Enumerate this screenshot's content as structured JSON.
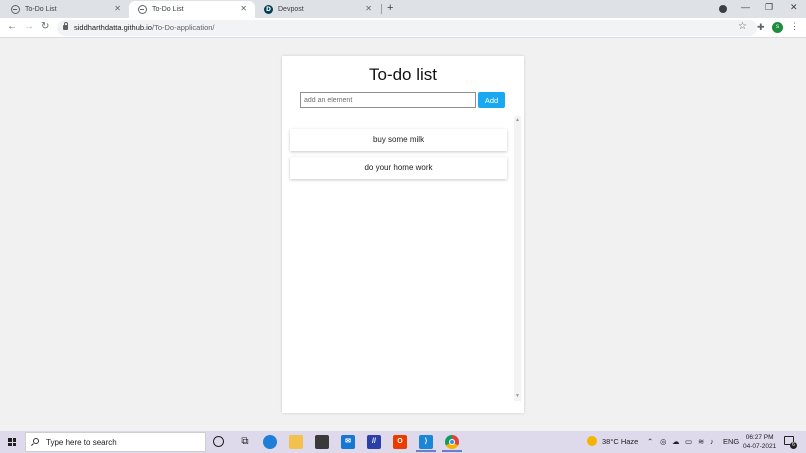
{
  "browser": {
    "tabs": [
      {
        "title": "To-Do List",
        "favicon": "globe-icon",
        "active": false
      },
      {
        "title": "To-Do List",
        "favicon": "globe-icon",
        "active": true
      },
      {
        "title": "Devpost",
        "favicon": "devpost-icon",
        "letter": "D",
        "active": false
      }
    ],
    "new_tab": "+",
    "close_glyph": "✕",
    "window_controls": {
      "minimize": "—",
      "maximize": "❐",
      "close": "✕"
    },
    "url_host": "siddharthdatta.github.io",
    "url_path": "/To-Do-application/",
    "profile_initial": "s"
  },
  "app": {
    "title": "To-do list",
    "input_placeholder": "add an element",
    "input_value": "",
    "add_label": "Add",
    "items": [
      "buy some milk",
      "do your home work"
    ]
  },
  "taskbar": {
    "search_placeholder": "Type here to search",
    "weather": "38°C  Haze",
    "language": "ENG",
    "time": "06:27 PM",
    "date": "04-07-2021",
    "notification_count": "6"
  },
  "colors": {
    "accent_button": "#1aa9f0",
    "page_background": "#f1f1f1",
    "taskbar": "#dfd9ec"
  }
}
